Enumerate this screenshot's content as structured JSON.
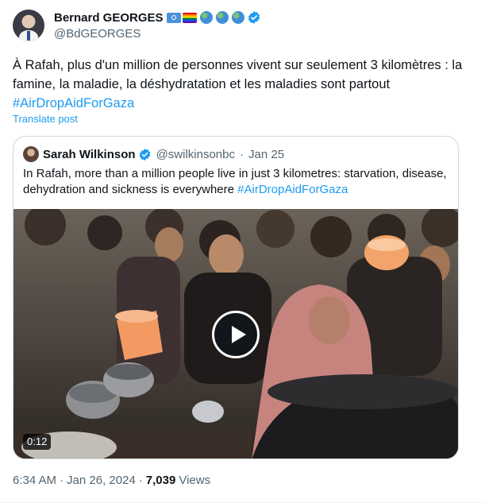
{
  "author": {
    "name": "Bernard GEORGES",
    "handle": "@BdGEORGES",
    "flags": [
      "un-flag-icon",
      "rainbow-flag-icon",
      "globe-icon",
      "globe-icon",
      "globe-icon"
    ],
    "verified": true
  },
  "tweet": {
    "text_main": "À Rafah, plus d'un million de personnes vivent sur seulement 3 kilomètres : la famine, la maladie, la déshydratation et les maladies sont partout ",
    "hashtag": "#AirDropAidForGaza",
    "translate_label": "Translate post"
  },
  "quote": {
    "name": "Sarah Wilkinson",
    "handle": "@swilkinsonbc",
    "separator": "·",
    "date": "Jan 25",
    "text_main": "In Rafah, more than a million people live in just 3 kilometres: starvation, disease, dehydration and sickness is everywhere ",
    "hashtag": "#AirDropAidForGaza",
    "video": {
      "duration": "0:12",
      "play_icon": "play-icon"
    }
  },
  "meta": {
    "time": "6:34 AM",
    "separator1": "·",
    "date": "Jan 26, 2024",
    "separator2": "·",
    "views_count": "7,039",
    "views_label": "Views"
  },
  "colors": {
    "link": "#1d9bf0",
    "secondary_text": "#536471",
    "primary_text": "#0f1419",
    "border": "#cfd9de"
  }
}
